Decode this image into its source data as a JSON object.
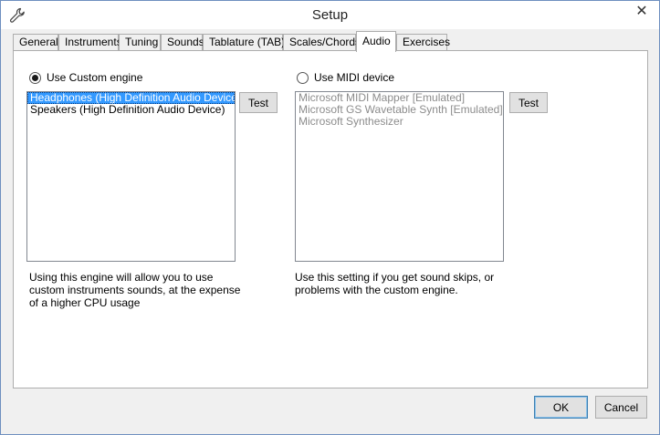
{
  "window": {
    "title": "Setup",
    "title_icon": "wrench-icon",
    "close_glyph": "✕"
  },
  "tabs": [
    {
      "label": "General",
      "active": false
    },
    {
      "label": "Instruments",
      "active": false
    },
    {
      "label": "Tuning",
      "active": false
    },
    {
      "label": "Sounds",
      "active": false
    },
    {
      "label": "Tablature (TAB)",
      "active": false
    },
    {
      "label": "Scales/Chords",
      "active": false
    },
    {
      "label": "Audio",
      "active": true
    },
    {
      "label": "Exercises",
      "active": false
    }
  ],
  "custom_engine": {
    "radio_label": "Use Custom engine",
    "selected": true,
    "devices": [
      {
        "label": "Headphones (High Definition Audio Device)",
        "selected": true
      },
      {
        "label": "Speakers (High Definition Audio Device)",
        "selected": false
      }
    ],
    "test_label": "Test",
    "description": "Using this engine will allow you to use\ncustom instruments sounds, at the expense\nof a higher CPU usage"
  },
  "midi_device": {
    "radio_label": "Use MIDI device",
    "selected": false,
    "devices": [
      {
        "label": "Microsoft MIDI Mapper [Emulated]"
      },
      {
        "label": "Microsoft GS Wavetable Synth [Emulated]"
      },
      {
        "label": "Microsoft Synthesizer"
      }
    ],
    "test_label": "Test",
    "description": "Use this setting if you get sound skips, or\nproblems with the custom engine."
  },
  "footer": {
    "ok_label": "OK",
    "cancel_label": "Cancel"
  },
  "colors": {
    "selection": "#3399ff",
    "disabled_text": "#8c8c8c"
  }
}
